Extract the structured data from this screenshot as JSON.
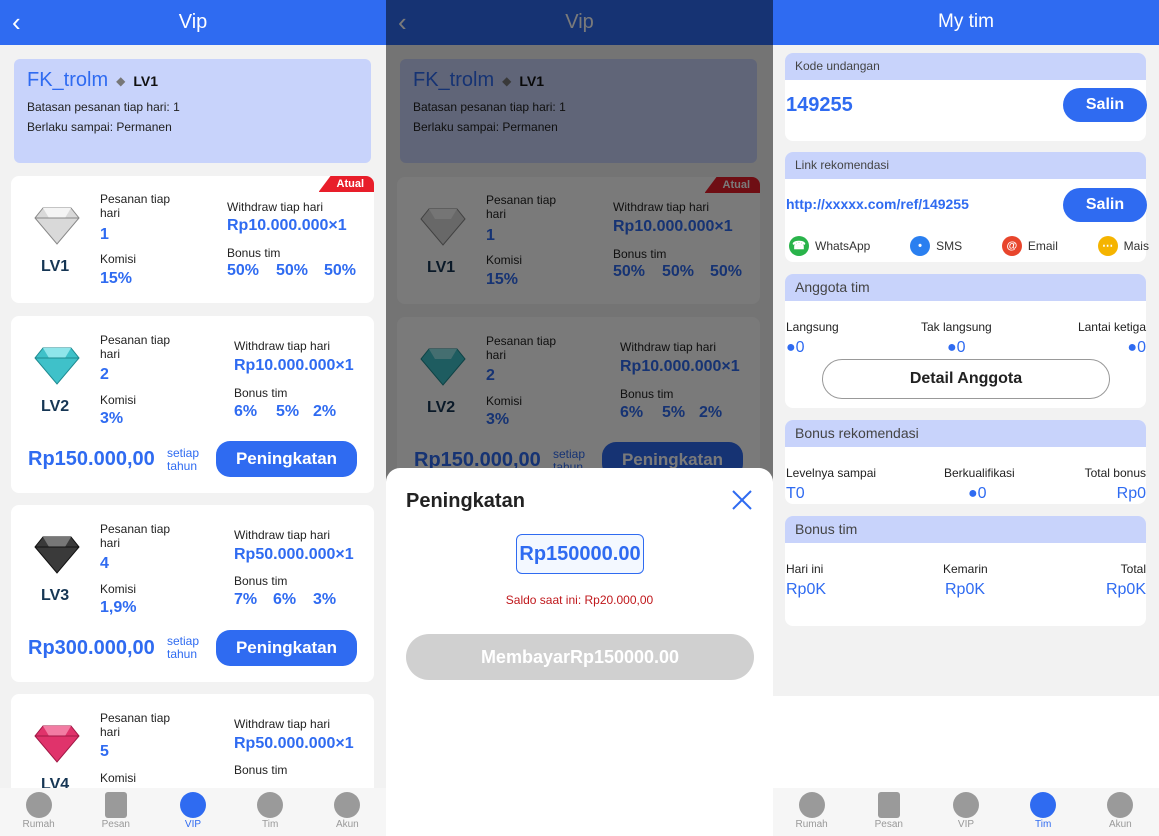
{
  "p1": {
    "title": "Vip",
    "user": {
      "name": "FK_trolm",
      "level": "LV1",
      "limit": "Batasan pesanan tiap hari: 1",
      "valid": "Berlaku sampai: Permanen"
    },
    "cards": [
      {
        "lv": "LV1",
        "orders_label": "Pesanan tiap hari",
        "orders": "1",
        "komisi_label": "Komisi",
        "komisi": "15%",
        "wd_label": "Withdraw tiap hari",
        "wd": "Rp10.000.000×1",
        "bonus_label": "Bonus tim",
        "bonus": [
          "50%",
          "50%",
          "50%"
        ],
        "badge": "Atual"
      },
      {
        "lv": "LV2",
        "orders_label": "Pesanan tiap hari",
        "orders": "2",
        "komisi_label": "Komisi",
        "komisi": "3%",
        "wd_label": "Withdraw tiap hari",
        "wd": "Rp10.000.000×1",
        "bonus_label": "Bonus tim",
        "bonus": [
          "6%",
          "5%",
          "2%"
        ],
        "price": "Rp150.000,00",
        "per": "setiap tahun",
        "btn": "Peningkatan"
      },
      {
        "lv": "LV3",
        "orders_label": "Pesanan tiap hari",
        "orders": "4",
        "komisi_label": "Komisi",
        "komisi": "1,9%",
        "wd_label": "Withdraw tiap hari",
        "wd": "Rp50.000.000×1",
        "bonus_label": "Bonus tim",
        "bonus": [
          "7%",
          "6%",
          "3%"
        ],
        "price": "Rp300.000,00",
        "per": "setiap tahun",
        "btn": "Peningkatan"
      },
      {
        "lv": "LV4",
        "orders_label": "Pesanan tiap hari",
        "orders": "5",
        "komisi_label": "Komisi",
        "wd_label": "Withdraw tiap hari",
        "wd": "Rp50.000.000×1",
        "bonus_label": "Bonus tim"
      }
    ],
    "nav": [
      "Rumah",
      "Pesan",
      "VIP",
      "Tim",
      "Akun"
    ]
  },
  "p2": {
    "sheet_title": "Peningkatan",
    "amount": "Rp150000.00",
    "balance": "Saldo saat ini: Rp20.000,00",
    "pay": "MembayarRp150000.00"
  },
  "p3": {
    "title": "My tim",
    "invite_label": "Kode undangan",
    "invite_code": "149255",
    "copy": "Salin",
    "link_label": "Link rekomendasi",
    "link": "http://xxxxx.com/ref/149255",
    "share": [
      "WhatsApp",
      "SMS",
      "Email",
      "Mais"
    ],
    "members_label": "Anggota tim",
    "members": [
      {
        "label": "Langsung",
        "value": "0"
      },
      {
        "label": "Tak langsung",
        "value": "0"
      },
      {
        "label": "Lantai ketiga",
        "value": "0"
      }
    ],
    "detail": "Detail Anggota",
    "rec_label": "Bonus rekomendasi",
    "rec": [
      {
        "label": "Levelnya sampai",
        "value": "T0"
      },
      {
        "label": "Berkualifikasi",
        "value": "0"
      },
      {
        "label": "Total bonus",
        "value": "Rp0"
      }
    ],
    "team_label": "Bonus tim",
    "team": [
      {
        "label": "Hari ini",
        "value": "Rp0K"
      },
      {
        "label": "Kemarin",
        "value": "Rp0K"
      },
      {
        "label": "Total",
        "value": "Rp0K"
      }
    ],
    "nav": [
      "Rumah",
      "Pesan",
      "VIP",
      "Tim",
      "Akun"
    ]
  },
  "colors": {
    "accent": "#2f6bf1",
    "badge": "#e81e2a",
    "panel": "#c8d3fb"
  }
}
